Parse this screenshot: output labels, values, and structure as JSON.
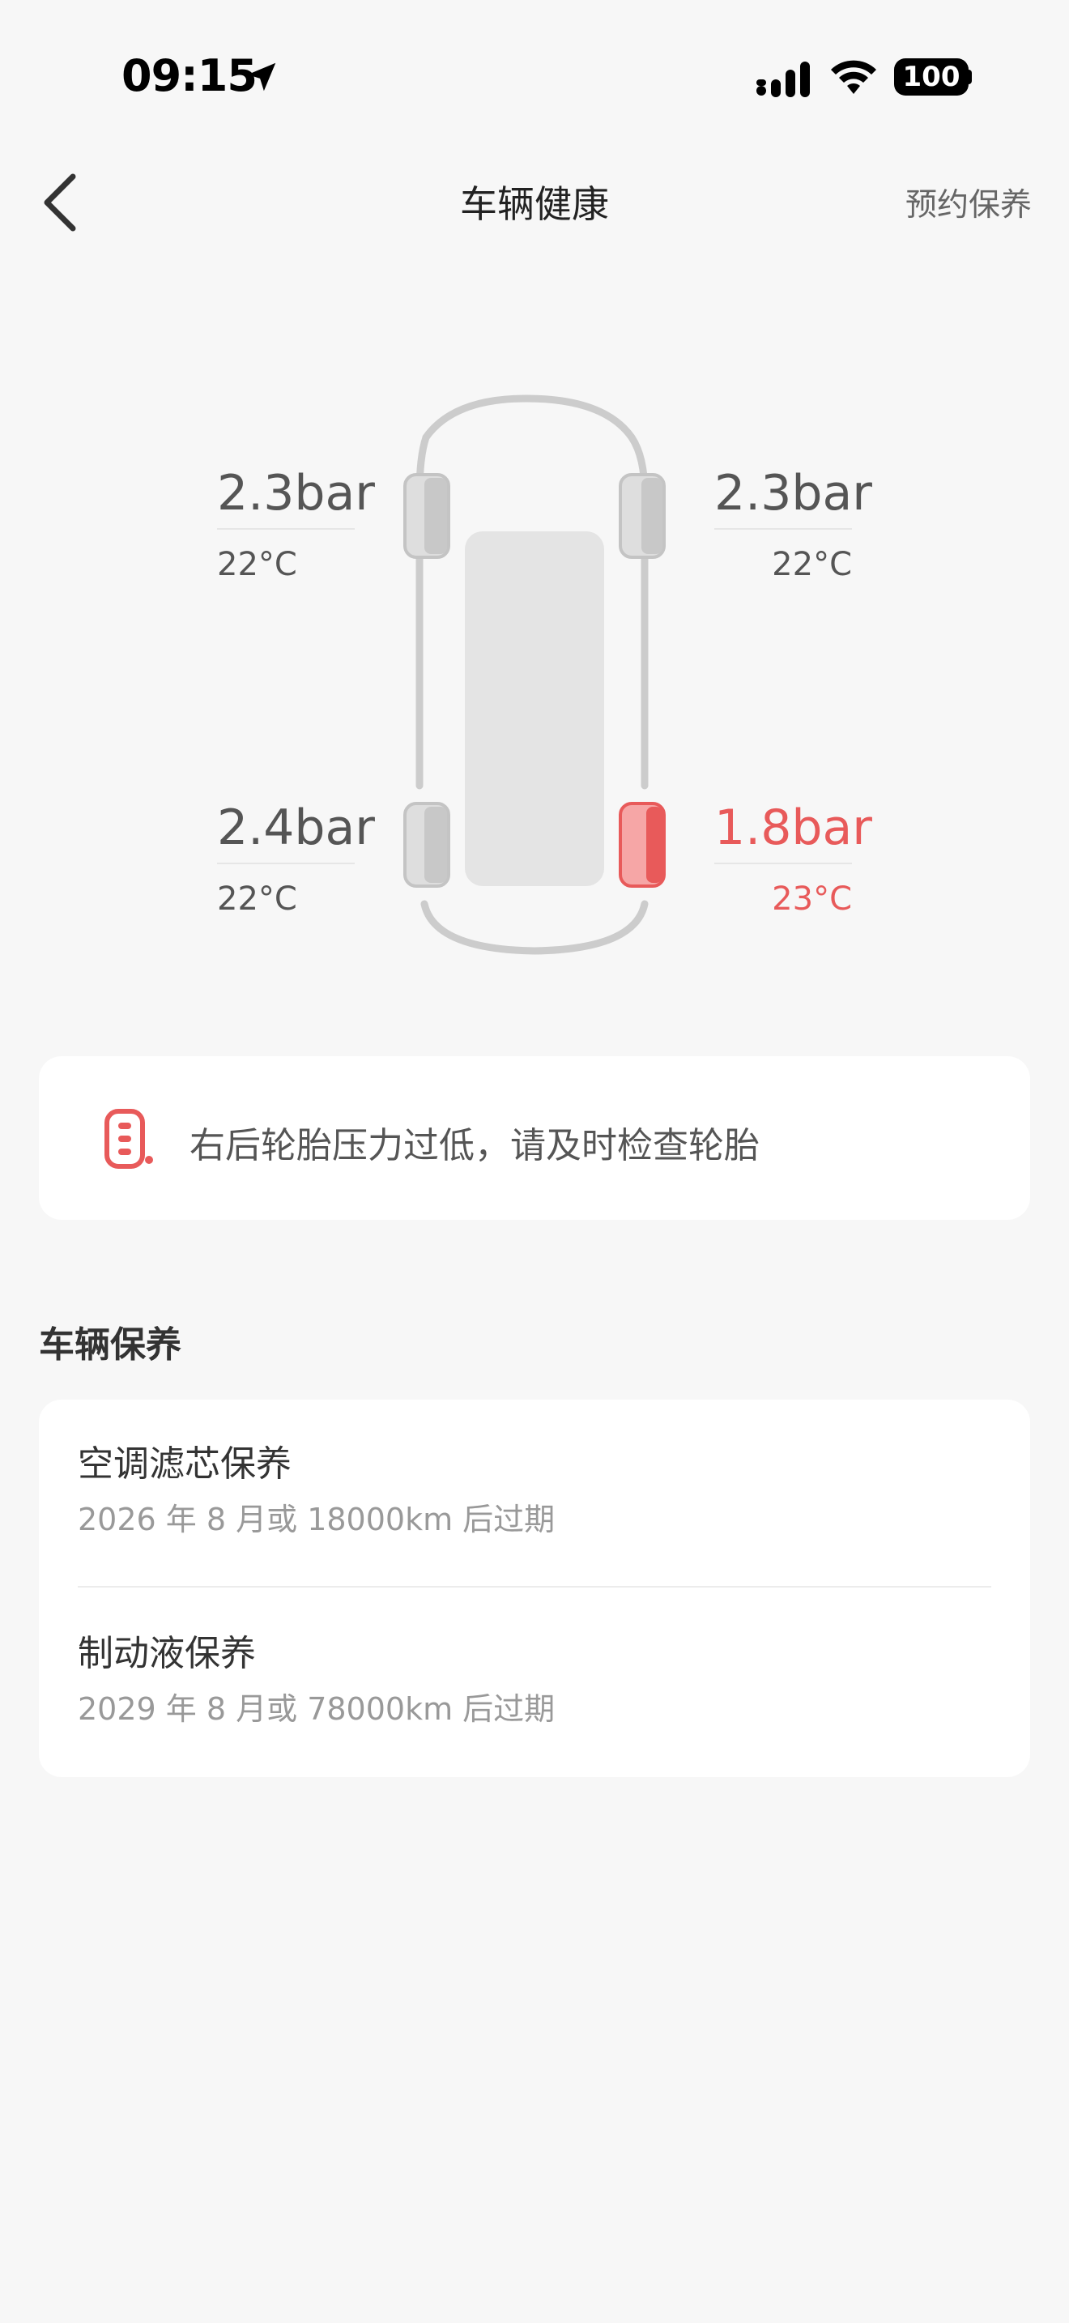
{
  "status_bar": {
    "time": "09:15",
    "battery": "100",
    "icons": [
      "location-arrow-icon",
      "cellular-signal-icon",
      "wifi-icon",
      "battery-icon"
    ]
  },
  "nav": {
    "back_icon": "chevron-left-icon",
    "title": "车辆健康",
    "action": "预约保养"
  },
  "tires": {
    "front_left": {
      "pressure": "2.3bar",
      "temp": "22°C",
      "status": "normal"
    },
    "front_right": {
      "pressure": "2.3bar",
      "temp": "22°C",
      "status": "normal"
    },
    "rear_left": {
      "pressure": "2.4bar",
      "temp": "22°C",
      "status": "normal"
    },
    "rear_right": {
      "pressure": "1.8bar",
      "temp": "23°C",
      "status": "alert"
    }
  },
  "colors": {
    "alert": "#e85a5a",
    "tire_normal": "#dddddd",
    "tire_alert": "#f6a6a6",
    "background": "#f7f7f7"
  },
  "warning": {
    "icon": "tire-alert-icon",
    "text": "右后轮胎压力过低，请及时检查轮胎"
  },
  "maintenance": {
    "title": "车辆保养",
    "items": [
      {
        "name": "空调滤芯保养",
        "desc": "2026 年 8 月或 18000km 后过期"
      },
      {
        "name": "制动液保养",
        "desc": "2029 年 8 月或 78000km 后过期"
      }
    ]
  }
}
